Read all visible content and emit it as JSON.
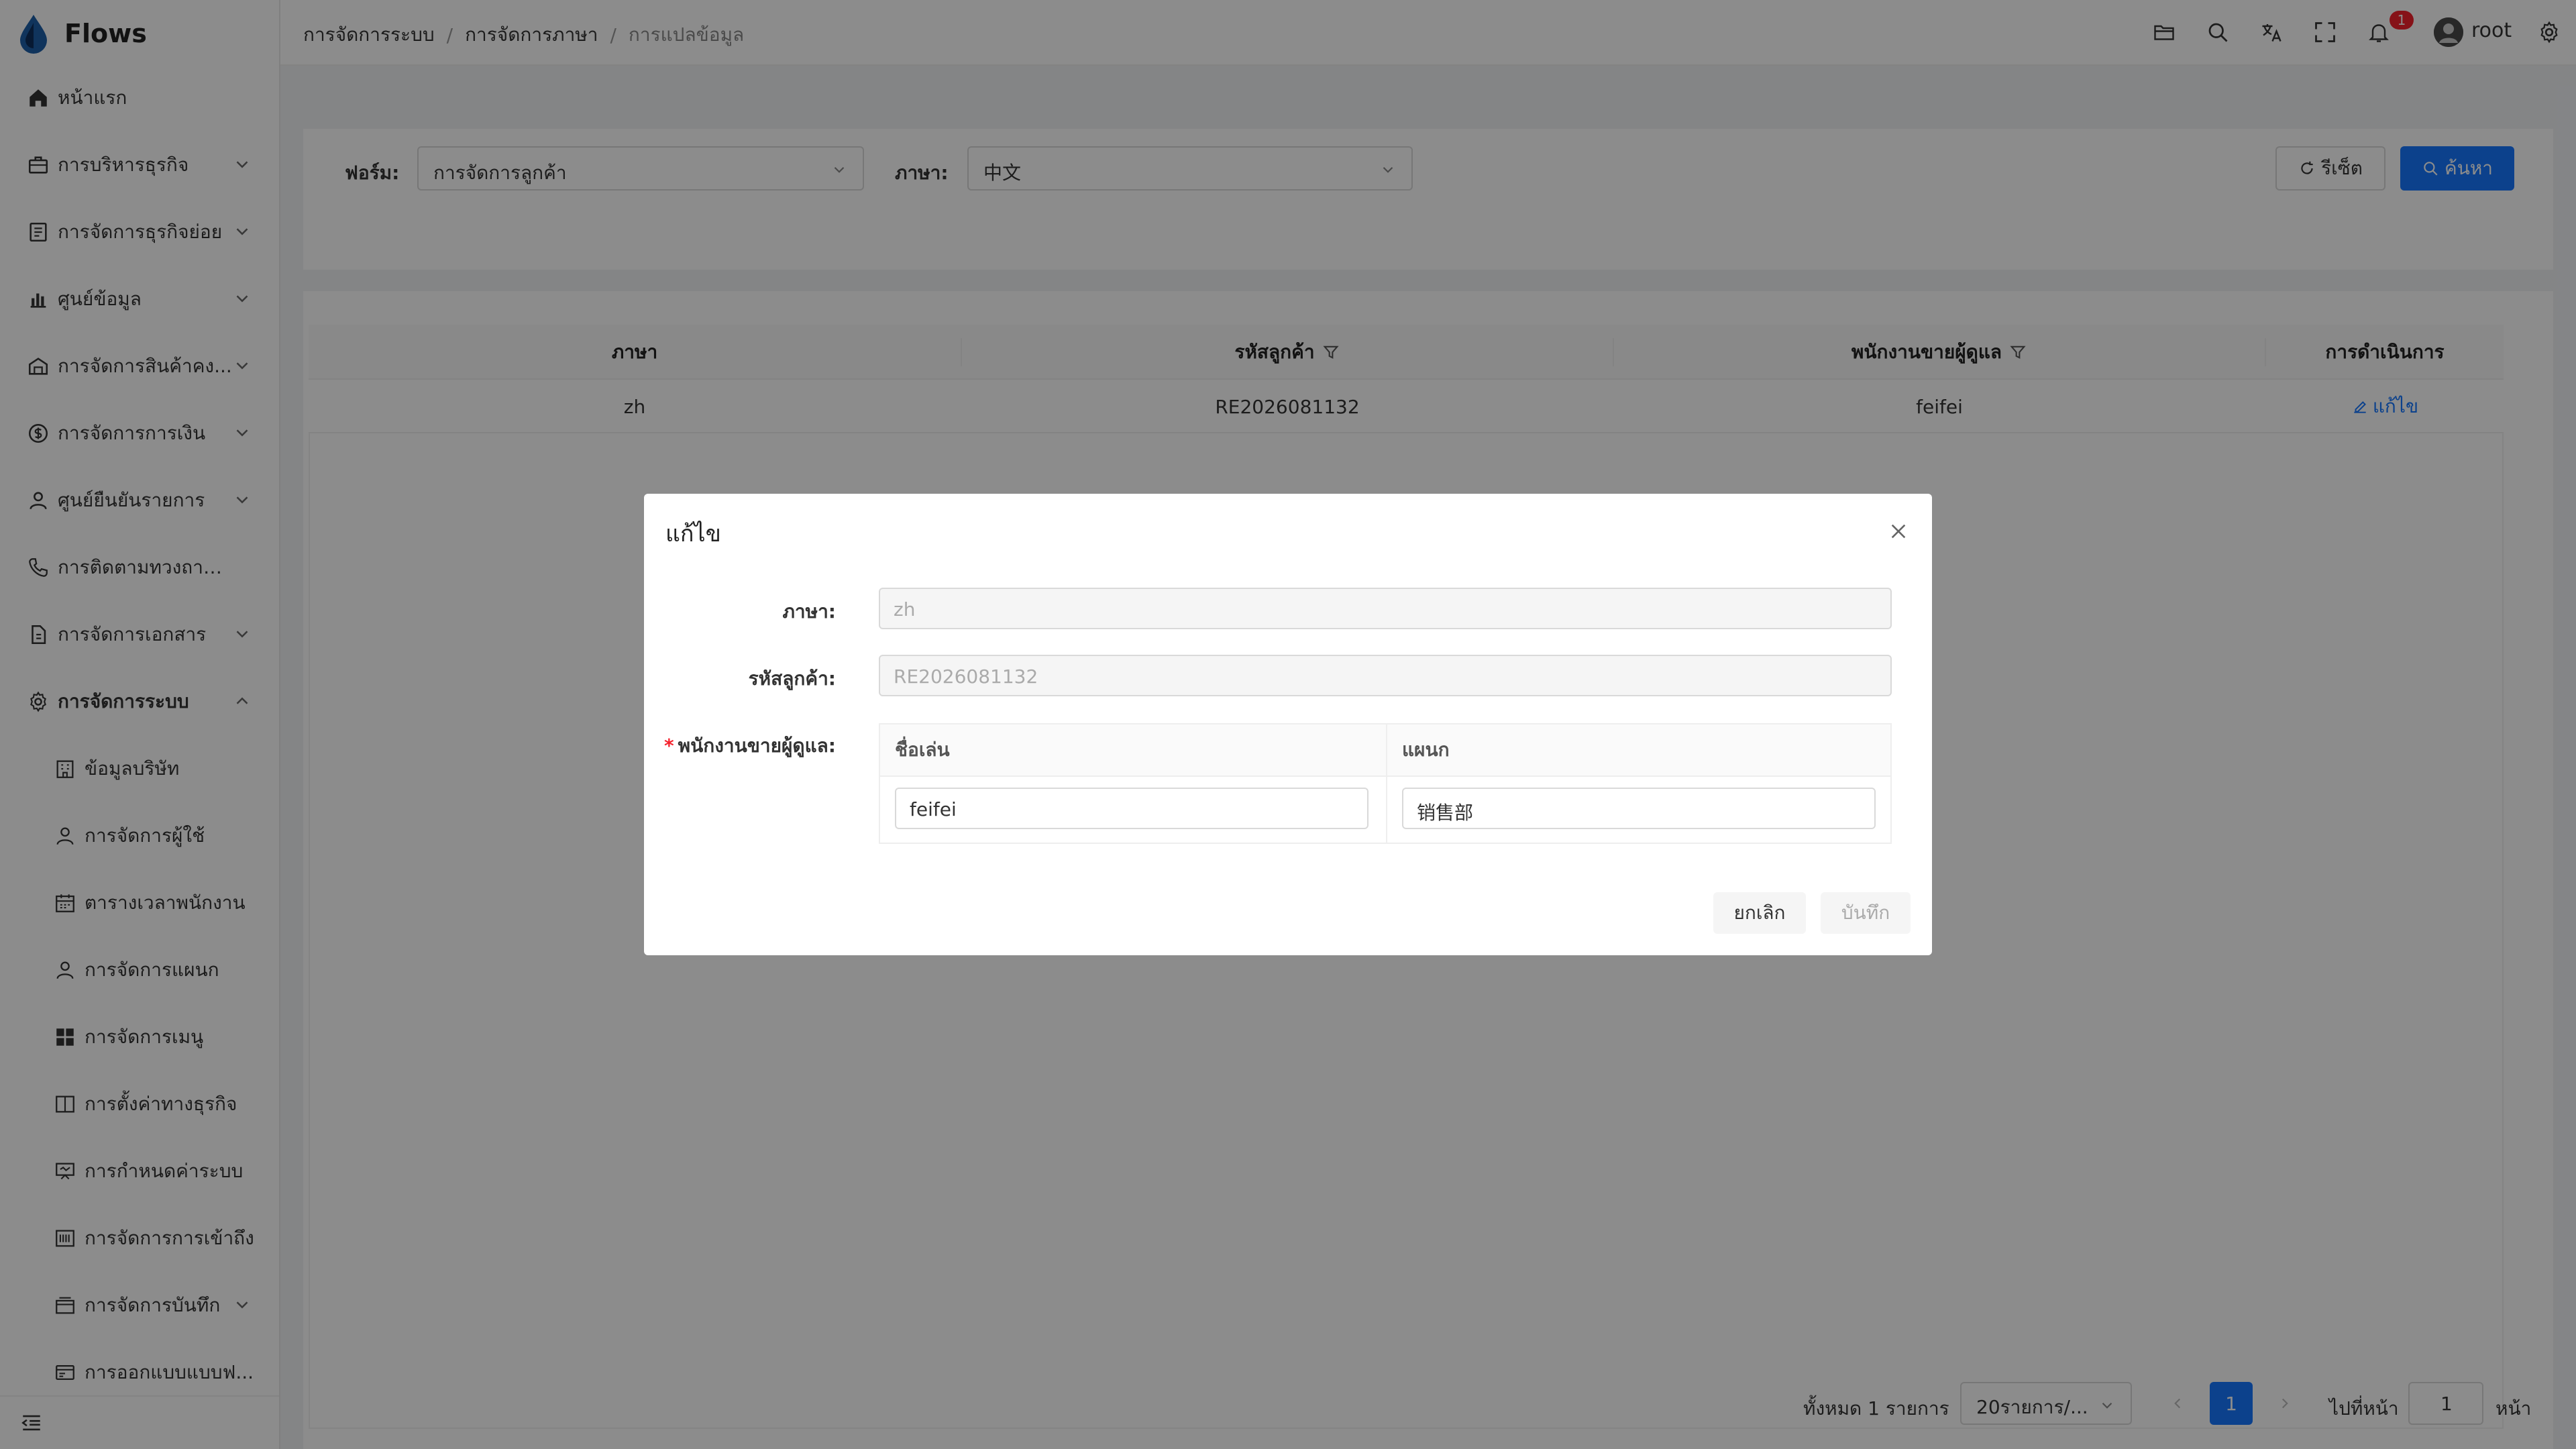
{
  "app": {
    "title": "Flows"
  },
  "sidebar": {
    "items": [
      {
        "label": "หน้าแรก",
        "icon": "home-icon",
        "has_children": false
      },
      {
        "label": "การบริหารธุรกิจ",
        "icon": "briefcase-icon",
        "has_children": true
      },
      {
        "label": "การจัดการธุรกิจย่อย",
        "icon": "document-list-icon",
        "has_children": true
      },
      {
        "label": "ศูนย์ข้อมูล",
        "icon": "bar-chart-icon",
        "has_children": true
      },
      {
        "label": "การจัดการสินค้าคง...",
        "icon": "warehouse-icon",
        "has_children": true
      },
      {
        "label": "การจัดการการเงิน",
        "icon": "money-icon",
        "has_children": true
      },
      {
        "label": "ศูนย์ยืนยันรายการ",
        "icon": "user-check-icon",
        "has_children": true
      },
      {
        "label": "การติดตามทวงถามหนี้",
        "icon": "phone-icon",
        "has_children": false
      },
      {
        "label": "การจัดการเอกสาร",
        "icon": "file-icon",
        "has_children": true
      },
      {
        "label": "การจัดการระบบ",
        "icon": "gear-icon",
        "has_children": true,
        "expanded": true
      }
    ],
    "subitems": [
      {
        "label": "ข้อมูลบริษัท",
        "icon": "building-icon"
      },
      {
        "label": "การจัดการผู้ใช้",
        "icon": "user-icon"
      },
      {
        "label": "ตารางเวลาพนักงาน",
        "icon": "calendar-icon"
      },
      {
        "label": "การจัดการแผนก",
        "icon": "department-icon"
      },
      {
        "label": "การจัดการเมนู",
        "icon": "grid-icon"
      },
      {
        "label": "การตั้งค่าทางธุรกิจ",
        "icon": "book-icon"
      },
      {
        "label": "การกำหนดค่าระบบ",
        "icon": "config-icon"
      },
      {
        "label": "การจัดการการเข้าถึง",
        "icon": "access-icon"
      },
      {
        "label": "การจัดการบันทึก",
        "icon": "log-icon",
        "has_children": true
      },
      {
        "label": "การออกแบบแบบฟ...",
        "icon": "form-design-icon"
      }
    ]
  },
  "header": {
    "breadcrumb": [
      "การจัดการระบบ",
      "การจัดการภาษา",
      "การแปลข้อมูล"
    ],
    "notification_count": "1",
    "username": "root"
  },
  "filter": {
    "form_label": "ฟอร์ม:",
    "form_value": "การจัดการลูกค้า",
    "lang_label": "ภาษา:",
    "lang_value": "中文",
    "reset_label": "รีเซ็ต",
    "search_label": "ค้นหา"
  },
  "table": {
    "columns": [
      "ภาษา",
      "รหัสลูกค้า",
      "พนักงานขายผู้ดูแล",
      "การดำเนินการ"
    ],
    "rows": [
      {
        "lang": "zh",
        "customer_code": "RE2026081132",
        "sales": "feifei",
        "action": "แก้ไข"
      }
    ]
  },
  "pagination": {
    "total": "ทั้งหมด 1 รายการ",
    "page_size": "20รายการ/...",
    "current_page": "1",
    "goto_label": "ไปที่หน้า",
    "goto_value": "1",
    "page_suffix": "หน้า"
  },
  "modal": {
    "title": "แก้ไข",
    "lang_label": "ภาษา:",
    "lang_value": "zh",
    "code_label": "รหัสลูกค้า:",
    "code_value": "RE2026081132",
    "sales_label": "พนักงานขายผู้ดูแล:",
    "required_mark": "*",
    "sub_columns": [
      "ชื่อเล่น",
      "แผนก"
    ],
    "nickname_value": "feifei",
    "dept_value": "销售部",
    "cancel_label": "ยกเลิก",
    "save_label": "บันทึก"
  },
  "colors": {
    "primary": "#1677ff",
    "badge": "#f5222d",
    "logo": "#1e5fa8"
  }
}
